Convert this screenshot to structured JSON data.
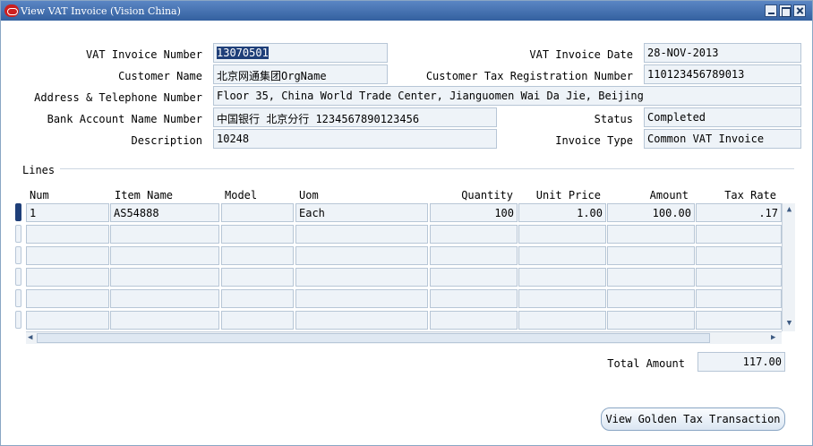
{
  "window": {
    "title": "View VAT Invoice (Vision China)"
  },
  "header": {
    "vat_invoice_number": {
      "label": "VAT Invoice Number",
      "value": "13070501"
    },
    "vat_invoice_date": {
      "label": "VAT Invoice Date",
      "value": "28-NOV-2013"
    },
    "customer_name": {
      "label": "Customer Name",
      "value": "北京网通集团OrgName"
    },
    "customer_tax_reg": {
      "label": "Customer Tax Registration Number",
      "value": "110123456789013"
    },
    "address": {
      "label": "Address & Telephone Number",
      "value": "Floor 35, China World Trade Center, Jianguomen Wai Da Jie, Beijing"
    },
    "bank_account": {
      "label": "Bank Account Name Number",
      "value": "中国银行 北京分行 1234567890123456"
    },
    "status": {
      "label": "Status",
      "value": "Completed"
    },
    "description": {
      "label": "Description",
      "value": "10248"
    },
    "invoice_type": {
      "label": "Invoice Type",
      "value": "Common VAT Invoice"
    }
  },
  "lines": {
    "section_label": "Lines",
    "columns": [
      "Num",
      "Item Name",
      "Model",
      "Uom",
      "Quantity",
      "Unit Price",
      "Amount",
      "Tax Rate"
    ],
    "rows": [
      [
        "1",
        "AS54888",
        "",
        "Each",
        "100",
        "1.00",
        "100.00",
        ".17"
      ],
      [
        "",
        "",
        "",
        "",
        "",
        "",
        "",
        ""
      ],
      [
        "",
        "",
        "",
        "",
        "",
        "",
        "",
        ""
      ],
      [
        "",
        "",
        "",
        "",
        "",
        "",
        "",
        ""
      ],
      [
        "",
        "",
        "",
        "",
        "",
        "",
        "",
        ""
      ],
      [
        "",
        "",
        "",
        "",
        "",
        "",
        "",
        ""
      ]
    ]
  },
  "total": {
    "label": "Total Amount",
    "value": "117.00"
  },
  "actions": {
    "view_golden_tax": "View Golden Tax Transaction"
  },
  "colors": {
    "titlebar": "#3f6db0",
    "field_bg": "#eef3f8",
    "field_border": "#b7c6d6",
    "selection": "#1f3f79"
  }
}
